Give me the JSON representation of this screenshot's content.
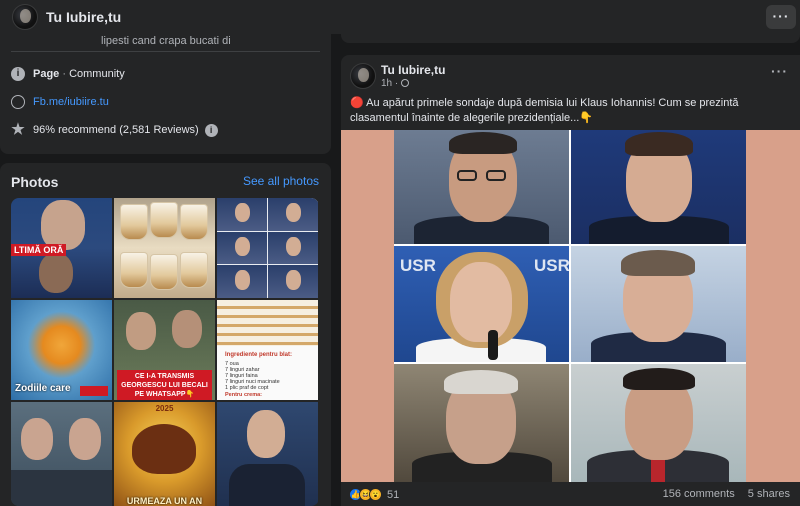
{
  "header": {
    "page_name": "Tu Iubire,tu",
    "more_label": "···"
  },
  "intro": {
    "cut_text": "lipesti cand crapa bucati di",
    "page_type_label": "Page",
    "page_type_sep": " · ",
    "page_category": "Community",
    "website": "Fb.me/iubiire.tu",
    "recommend": "96% recommend (2,581 Reviews)"
  },
  "photos": {
    "title": "Photos",
    "see_all": "See all photos",
    "captions": {
      "p1": "LTIMĂ ORĂ",
      "p4": "Zodiile care",
      "p5": "CE I-A TRANSMIS GEORGESCU LUI BECALI PE WHATSAPP👇",
      "p6_title": "Ingrediente pentru blat:",
      "p6_lines": [
        "7 oua",
        "7 linguri zahar",
        "7 linguri faina",
        "7 linguri nuci macinate",
        "1 plic praf de copt",
        "Pentru crema:"
      ],
      "p8_year": "2025",
      "p8_caption": "URMEAZA UN AN"
    }
  },
  "post": {
    "author": "Tu Iubire,tu",
    "time": "1h · ",
    "privacy_icon": "globe-icon",
    "more_label": "···",
    "text": "🔴 Au apărut primele sondaje după demisia lui Klaus Iohannis! Cum se prezintă clasamentul înainte de alegerile prezidențiale...👇",
    "image_labels": {
      "usr": "USR"
    },
    "reaction_count": "51",
    "comments": "156 comments",
    "shares": "5 shares"
  },
  "colors": {
    "background": "#18191a",
    "card": "#242526",
    "link": "#4599ff",
    "text": "#e4e6eb",
    "muted": "#b0b3b8"
  }
}
